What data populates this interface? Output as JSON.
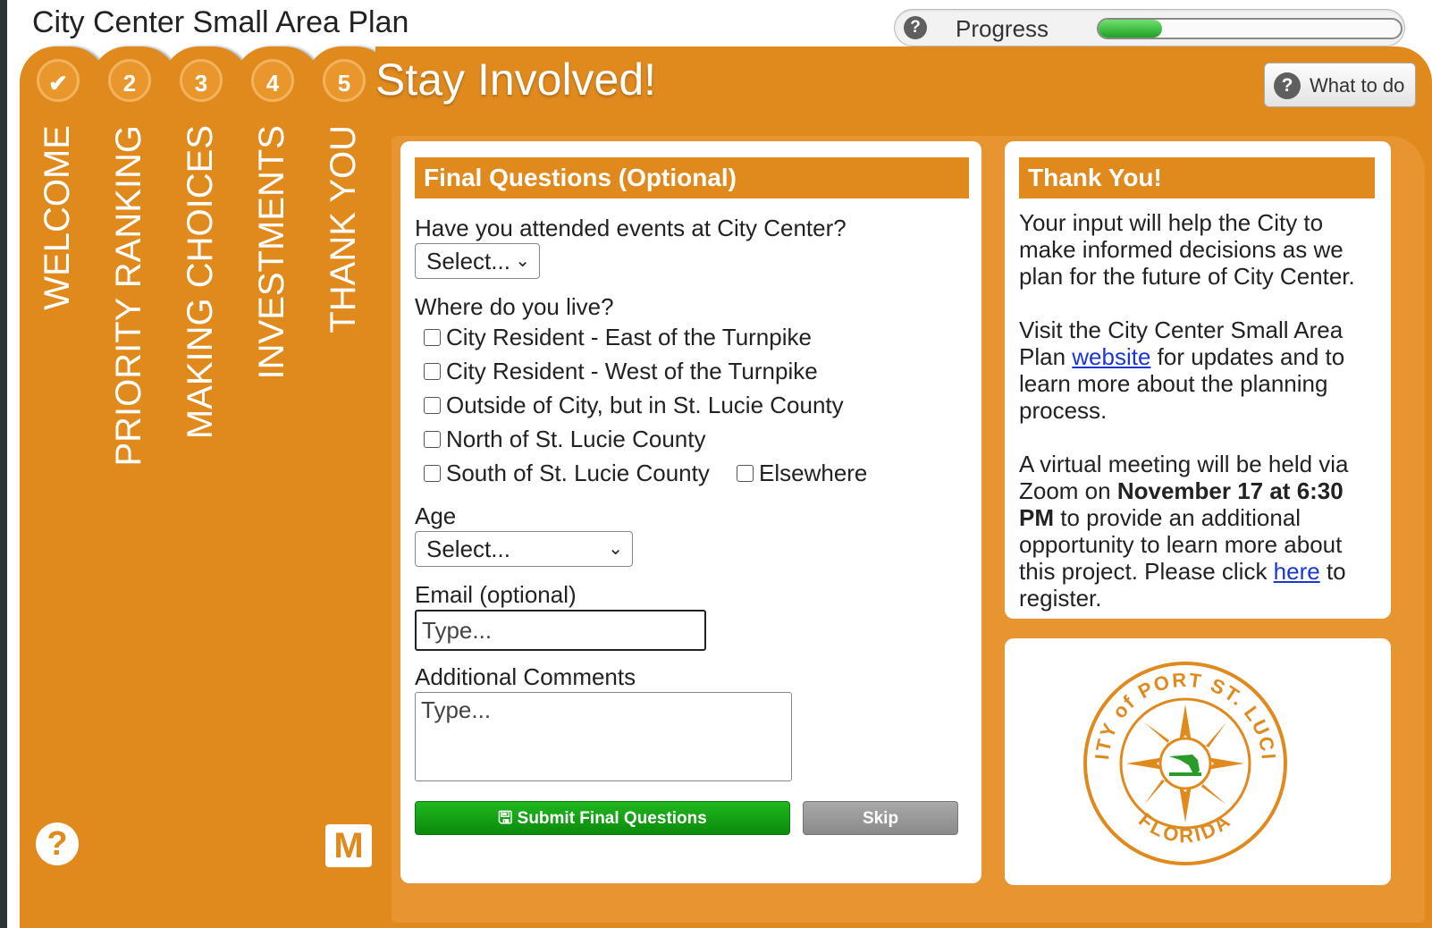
{
  "app": {
    "title": "City Center Small Area Plan"
  },
  "progress": {
    "label": "Progress",
    "help_icon": "?",
    "fraction": 0.21
  },
  "tabs": [
    {
      "number": "✔",
      "label": "WELCOME"
    },
    {
      "number": "2",
      "label": "PRIORITY RANKING"
    },
    {
      "number": "3",
      "label": "MAKING CHOICES"
    },
    {
      "number": "4",
      "label": "INVESTMENTS"
    },
    {
      "number": "5",
      "label": "THANK YOU"
    }
  ],
  "stage": {
    "title": "Stay Involved!"
  },
  "what_to_do": {
    "label": "What to do",
    "icon": "?"
  },
  "help_icon": "?",
  "logo_text": "M",
  "form": {
    "heading": "Final Questions (Optional)",
    "q_events": {
      "label": "Have you attended events at City Center?",
      "value": "Select..."
    },
    "q_live": {
      "label": "Where do you live?",
      "options": [
        "City Resident - East of the Turnpike",
        "City Resident - West of the Turnpike",
        "Outside of City, but in St. Lucie County",
        "North of St. Lucie County",
        "South of St. Lucie County",
        "Elsewhere"
      ]
    },
    "age": {
      "label": "Age",
      "value": "Select..."
    },
    "email": {
      "label": "Email (optional)",
      "placeholder": "Type..."
    },
    "comments": {
      "label": "Additional Comments",
      "placeholder": "Type..."
    },
    "submit_label": "Submit Final Questions",
    "skip_label": "Skip"
  },
  "thanks": {
    "heading": "Thank You!",
    "p1": "Your input will help the City to make informed decisions as we plan for the future of City Center.",
    "p2_before": "Visit the City Center Small Area Plan ",
    "p2_link": "website",
    "p2_after": " for updates and to learn more about the planning process.",
    "p3_before": "A virtual meeting will be held via Zoom on ",
    "p3_bold": "November 17 at 6:30 PM",
    "p3_mid": " to provide an additional opportunity to learn more about this project. Please click ",
    "p3_link": "here",
    "p3_after": " to register."
  },
  "seal": {
    "top_text": "CITY of PORT ST. LUCIE",
    "bottom_text": "FLORIDA"
  },
  "colors": {
    "accent": "#e08a1e",
    "submit": "#12a012",
    "skip": "#999999",
    "link": "#1a37d6"
  }
}
